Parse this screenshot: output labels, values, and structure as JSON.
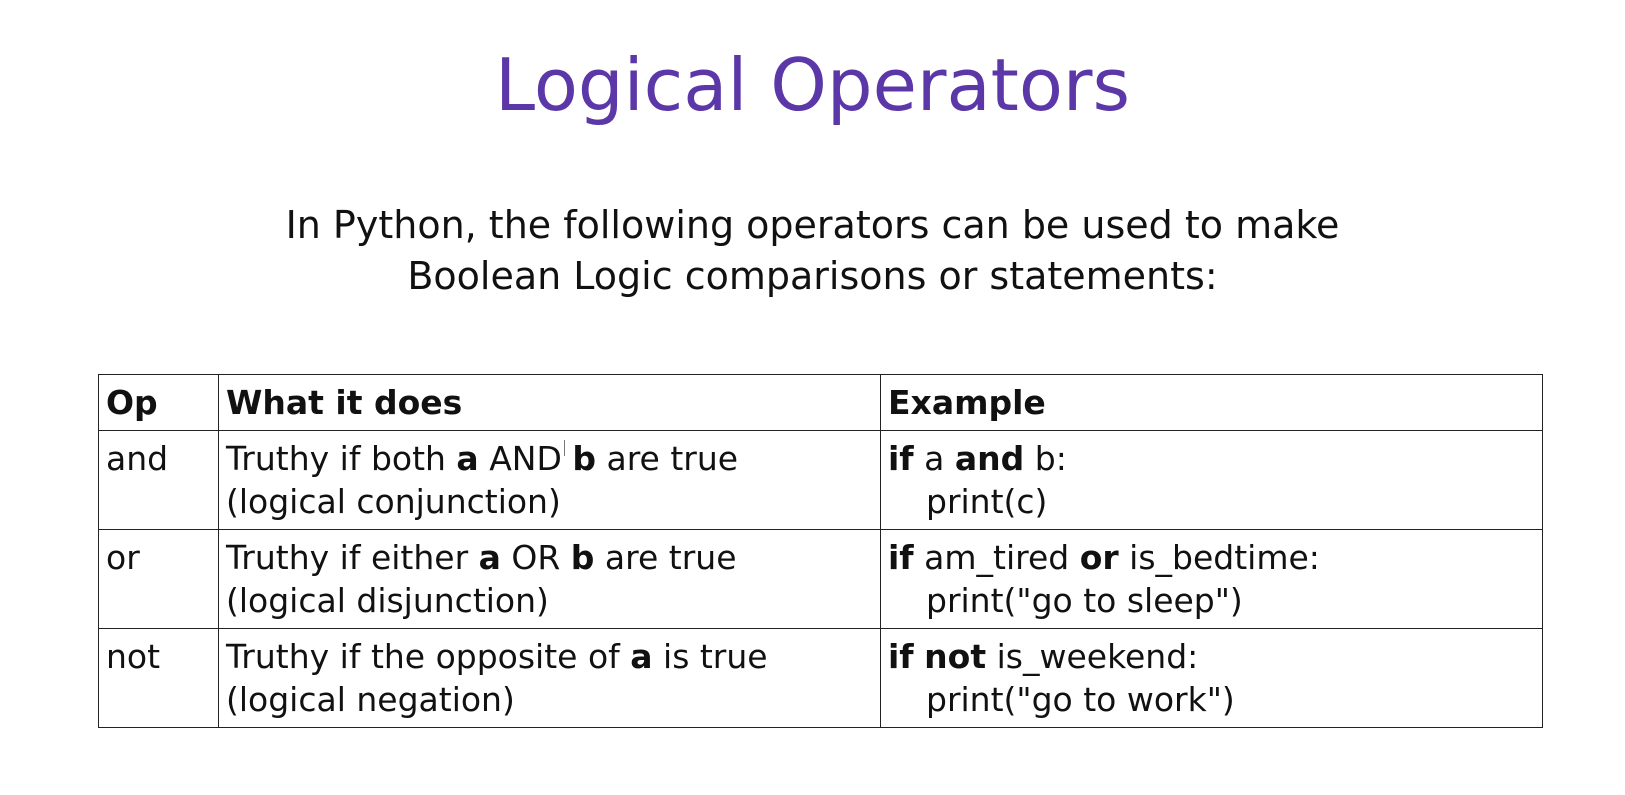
{
  "slide": {
    "title": "Logical Operators",
    "intro_line1": "In Python, the following operators can be used to make",
    "intro_line2": "Boolean Logic comparisons or statements:",
    "title_color": "#5b37a8"
  },
  "table": {
    "headers": [
      "Op",
      "What it does",
      "Example"
    ],
    "rows": [
      {
        "op": "and",
        "desc_pre": "Truthy if both ",
        "desc_a": "a",
        "desc_mid": " AND ",
        "desc_b": "b",
        "desc_post": " are true",
        "desc_line2": "(logical conjunction)",
        "ex_kw1": "if",
        "ex_t1": " a ",
        "ex_kw2": "and",
        "ex_t2": " b:",
        "ex_line2": "print(c)"
      },
      {
        "op": "or",
        "desc_pre": "Truthy if either ",
        "desc_a": "a",
        "desc_mid": " OR ",
        "desc_b": "b",
        "desc_post": " are true",
        "desc_line2": "(logical disjunction)",
        "ex_kw1": "if",
        "ex_t1": " am_tired ",
        "ex_kw2": "or",
        "ex_t2": " is_bedtime:",
        "ex_line2": "print(\"go to sleep\")"
      },
      {
        "op": "not",
        "desc_pre": "Truthy if the opposite of ",
        "desc_a": "a",
        "desc_post": " is true",
        "desc_line2": "(logical negation)",
        "ex_kw1": "if",
        "ex_t1": " ",
        "ex_kw2": "not",
        "ex_t2": " is_weekend:",
        "ex_line2": "print(\"go to work\")"
      }
    ]
  }
}
